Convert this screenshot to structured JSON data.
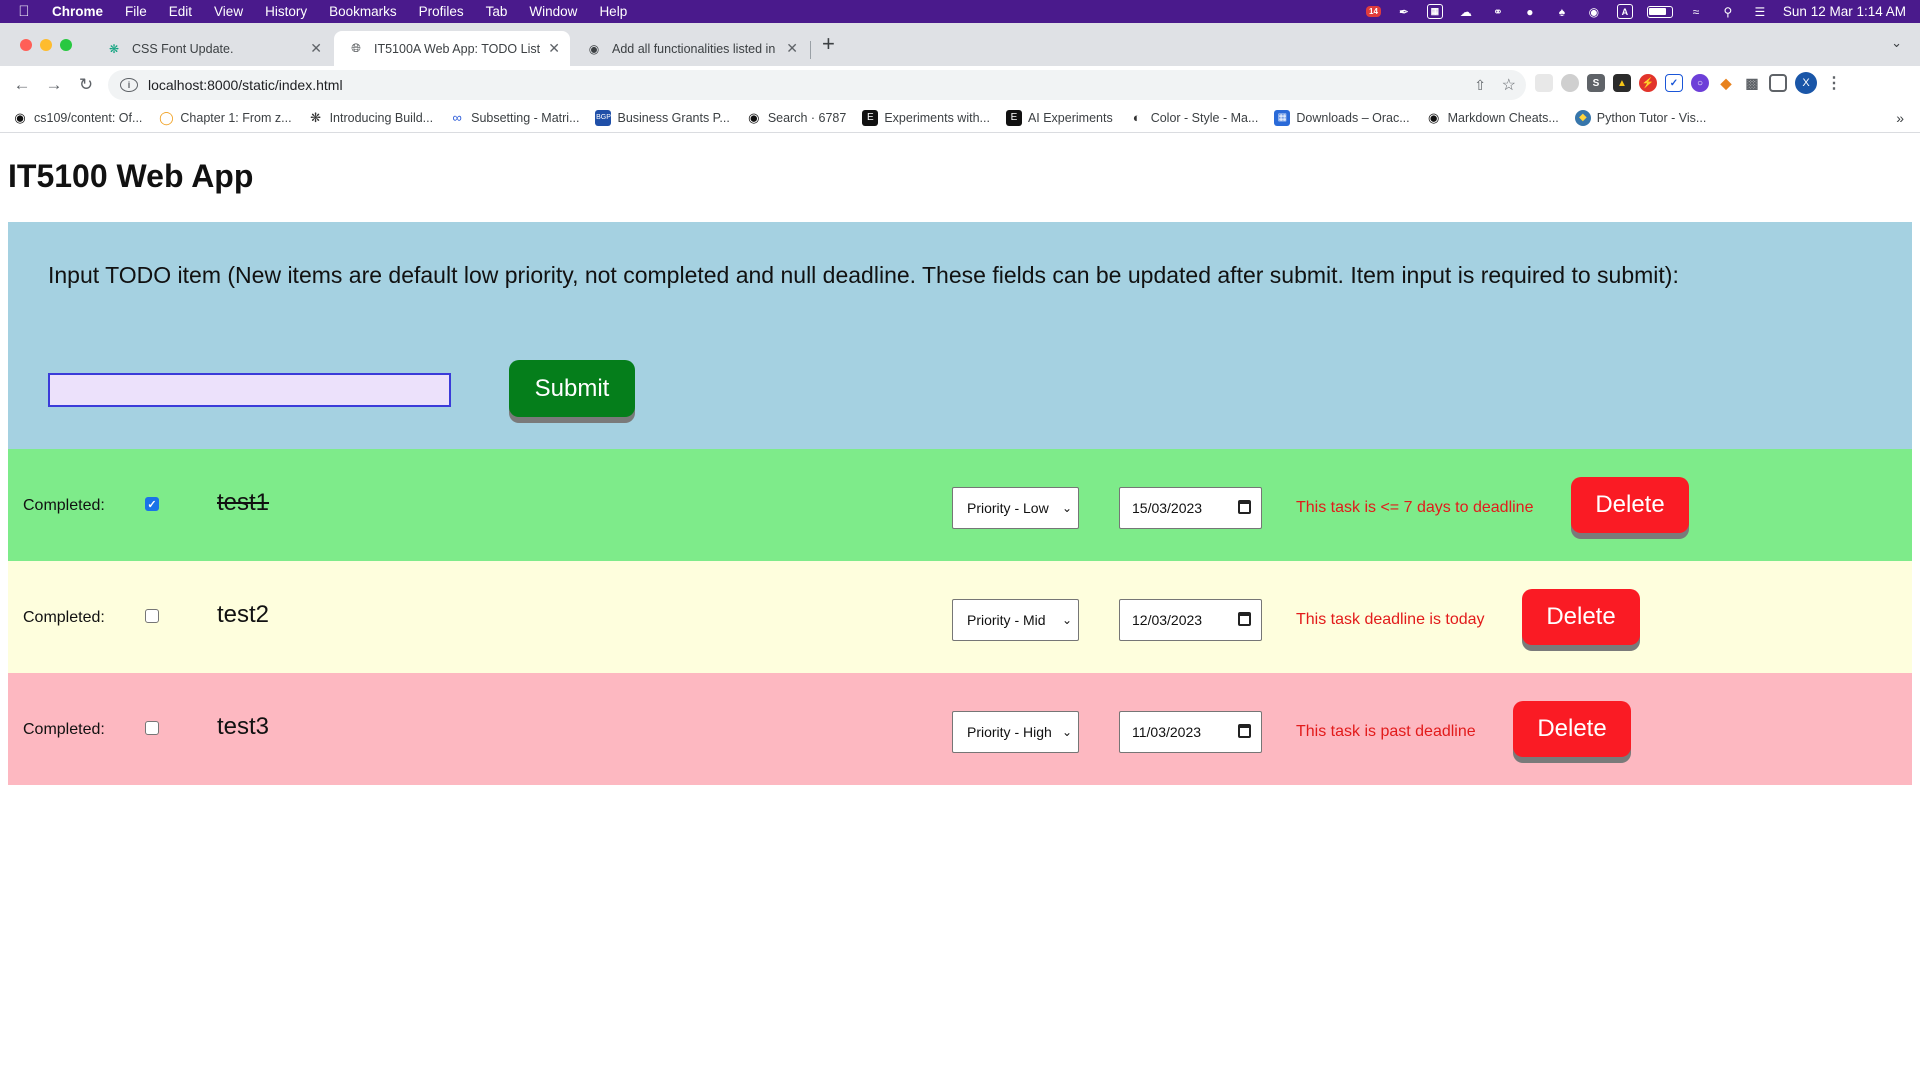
{
  "menubar": {
    "app_name": "Chrome",
    "menus": [
      "File",
      "Edit",
      "View",
      "History",
      "Bookmarks",
      "Profiles",
      "Tab",
      "Window",
      "Help"
    ],
    "badge": "14",
    "clock": "Sun 12 Mar  1:14 AM"
  },
  "tabs": [
    {
      "title": "CSS Font Update.",
      "icon": "chatgpt-icon"
    },
    {
      "title": "IT5100A Web App: TODO List",
      "icon": "globe-icon"
    },
    {
      "title": "Add all functionalities listed in",
      "icon": "github-icon"
    }
  ],
  "toolbar": {
    "url": "localhost:8000/static/index.html",
    "profile_initial": "X"
  },
  "bookmarks": [
    {
      "label": "cs109/content: Of...",
      "icon": "github-icon"
    },
    {
      "label": "Chapter 1: From z...",
      "icon": "book-icon"
    },
    {
      "label": "Introducing Build...",
      "icon": "openai-icon"
    },
    {
      "label": "Subsetting - Matri...",
      "icon": "link-icon"
    },
    {
      "label": "Business Grants P...",
      "icon": "bgp-icon"
    },
    {
      "label": "Search · 6787",
      "icon": "github-icon"
    },
    {
      "label": "Experiments with...",
      "icon": "e-icon"
    },
    {
      "label": "AI Experiments",
      "icon": "e-icon"
    },
    {
      "label": "Color - Style - Ma...",
      "icon": "material-icon"
    },
    {
      "label": "Downloads – Orac...",
      "icon": "oracle-icon"
    },
    {
      "label": "Markdown Cheats...",
      "icon": "github-icon"
    },
    {
      "label": "Python Tutor - Vis...",
      "icon": "python-icon"
    }
  ],
  "page": {
    "title": "IT5100 Web App",
    "instructions": "Input TODO item (New items are default low priority, not completed and null deadline. These fields can be updated after submit. Item input is required to submit):",
    "input_value": "",
    "submit_label": "Submit",
    "todos": [
      {
        "completed_label": "Completed:",
        "completed": true,
        "text": "test1",
        "priority": "Priority - Low",
        "deadline": "15/03/2023",
        "message": "This task is <= 7 days to deadline",
        "delete_label": "Delete",
        "row_color": "#7eeb8a"
      },
      {
        "completed_label": "Completed:",
        "completed": false,
        "text": "test2",
        "priority": "Priority - Mid",
        "deadline": "12/03/2023",
        "message": "This task deadline is today",
        "delete_label": "Delete",
        "row_color": "#fefedd"
      },
      {
        "completed_label": "Completed:",
        "completed": false,
        "text": "test3",
        "priority": "Priority - High",
        "deadline": "11/03/2023",
        "message": "This task is past deadline",
        "delete_label": "Delete",
        "row_color": "#fdb8c1"
      }
    ]
  },
  "colors": {
    "menubar_bg": "#4a1a8c",
    "form_bg": "#a5d1e1",
    "submit_bg": "#057e1b",
    "delete_bg": "#fa1b24",
    "warning_text": "#e21b1b"
  }
}
